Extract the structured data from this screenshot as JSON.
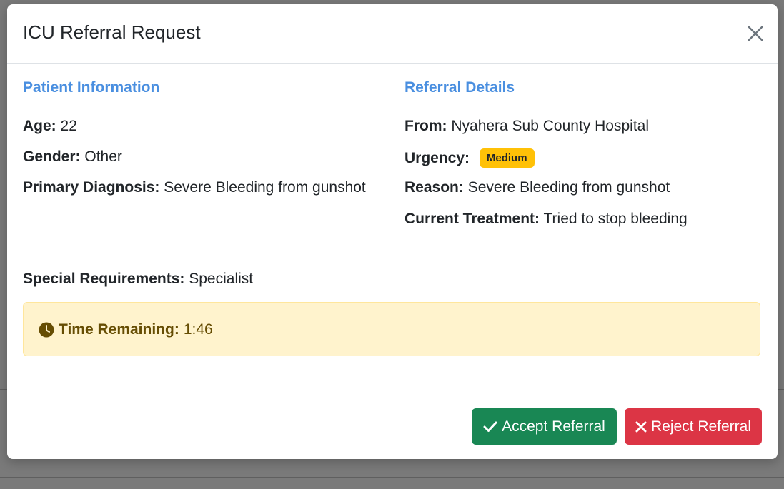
{
  "modal": {
    "title": "ICU Referral Request",
    "patient": {
      "heading": "Patient Information",
      "age_label": "Age:",
      "age": "22",
      "gender_label": "Gender:",
      "gender": "Other",
      "diagnosis_label": "Primary Diagnosis:",
      "diagnosis": "Severe Bleeding from gunshot"
    },
    "referral": {
      "heading": "Referral Details",
      "from_label": "From:",
      "from": "Nyahera Sub County Hospital",
      "urgency_label": "Urgency:",
      "urgency": "Medium",
      "reason_label": "Reason:",
      "reason": "Severe Bleeding from gunshot",
      "treatment_label": "Current Treatment:",
      "treatment": "Tried to stop bleeding"
    },
    "special_label": "Special Requirements:",
    "special": "Specialist",
    "timer": {
      "label": "Time Remaining:",
      "value": "1:46"
    },
    "accept_label": "Accept Referral",
    "reject_label": "Reject Referral"
  },
  "colors": {
    "heading": "#4a8fe0",
    "accept": "#198754",
    "reject": "#dc3545",
    "badge": "#ffc107",
    "alert_bg": "#fff3cd"
  }
}
